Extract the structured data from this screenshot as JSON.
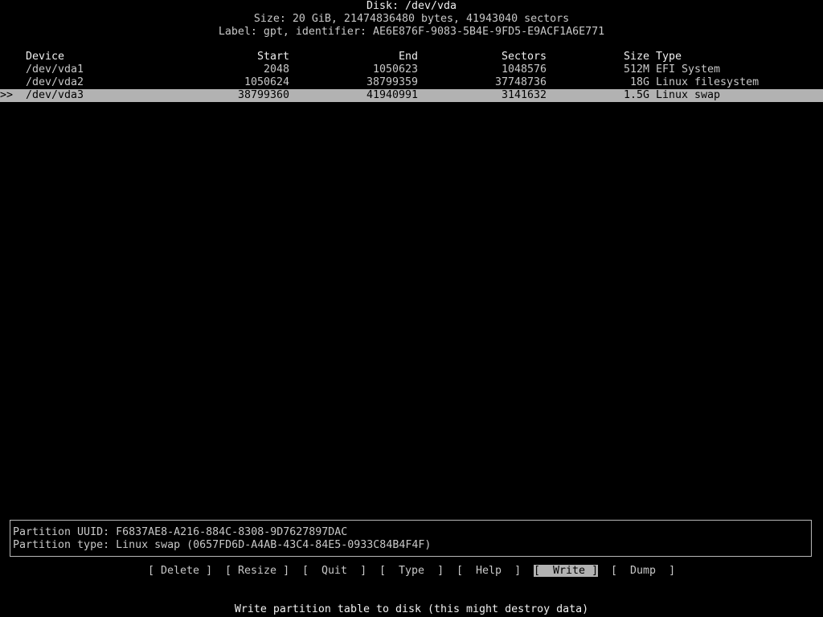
{
  "header": {
    "disk": "Disk: /dev/vda",
    "size": "Size: 20 GiB, 21474836480 bytes, 41943040 sectors",
    "label": "Label: gpt, identifier: AE6E876F-9083-5B4E-9FD5-E9ACF1A6E771"
  },
  "table": {
    "columns": {
      "device": "Device",
      "start": "Start",
      "end": "End",
      "sectors": "Sectors",
      "size": "Size",
      "type": "Type"
    },
    "rows": [
      {
        "marker": "",
        "device": "/dev/vda1",
        "start": "2048",
        "end": "1050623",
        "sectors": "1048576",
        "size": "512M",
        "type": "EFI System"
      },
      {
        "marker": "",
        "device": "/dev/vda2",
        "start": "1050624",
        "end": "38799359",
        "sectors": "37748736",
        "size": "18G",
        "type": "Linux filesystem"
      },
      {
        "marker": ">>",
        "device": "/dev/vda3",
        "start": "38799360",
        "end": "41940991",
        "sectors": "3141632",
        "size": "1.5G",
        "type": "Linux swap"
      }
    ]
  },
  "info": {
    "uuid": "Partition UUID: F6837AE8-A216-884C-8308-9D7627897DAC",
    "type": "Partition type: Linux swap (0657FD6D-A4AB-43C4-84E5-0933C84B4F4F)"
  },
  "menu": {
    "delete": "Delete",
    "resize": "Resize",
    "quit": "Quit",
    "type": "Type",
    "help": "Help",
    "write": "Write",
    "dump": "Dump"
  },
  "status": {
    "hint": "Write partition table to disk (this might destroy data)"
  },
  "colors": {
    "background": "#000000",
    "text": "#c8c8c8",
    "highlight": "#b2b2b2"
  }
}
